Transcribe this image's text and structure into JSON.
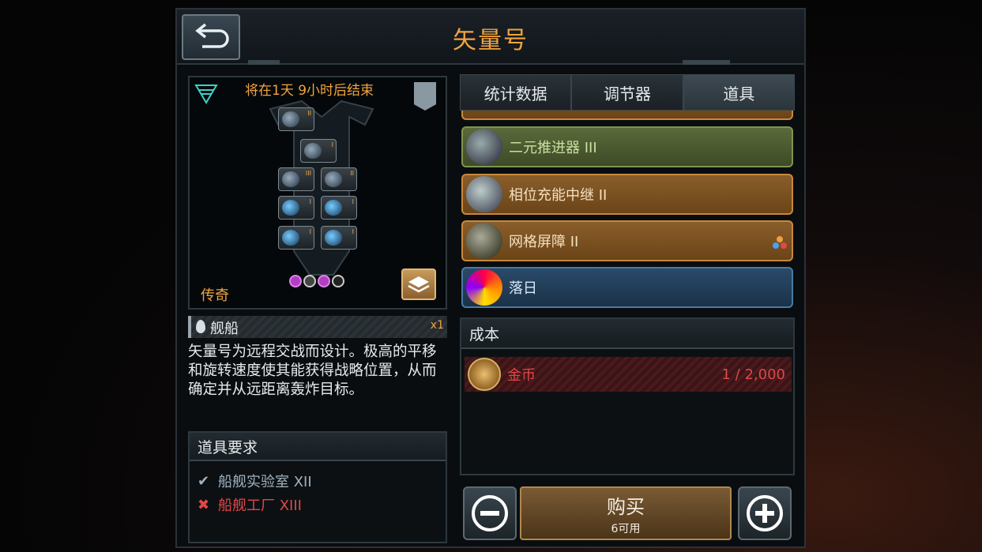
{
  "header": {
    "title": "矢量号"
  },
  "ship": {
    "timer": "将在1天 9小时后结束",
    "rarity": "传奇",
    "type_label": "舰船",
    "count": "x1",
    "description": "矢量号为远程交战而设计。极高的平移和旋转速度使其能获得战略位置，从而确定并从远距离轰炸目标。",
    "slot_levels": [
      "II",
      "I",
      "III",
      "II",
      "I",
      "I",
      "I",
      "I"
    ]
  },
  "requirements": {
    "title": "道具要求",
    "items": [
      {
        "label": "船舰实验室 XII",
        "met": true
      },
      {
        "label": "船舰工厂 XIII",
        "met": false
      }
    ]
  },
  "tabs": [
    "统计数据",
    "调节器",
    "道具"
  ],
  "items": [
    {
      "name": "二元推进器 III",
      "tier": "green"
    },
    {
      "name": "相位充能中继 II",
      "tier": "orange"
    },
    {
      "name": "网格屏障 II",
      "tier": "orange"
    },
    {
      "name": "落日",
      "tier": "blue"
    }
  ],
  "cost": {
    "title": "成本",
    "currency": "金币",
    "amount": "1 / 2,000"
  },
  "buy": {
    "label": "购买",
    "available": "6可用"
  },
  "colors": {
    "accent_orange": "#f0a440",
    "error_red": "#e04848"
  }
}
